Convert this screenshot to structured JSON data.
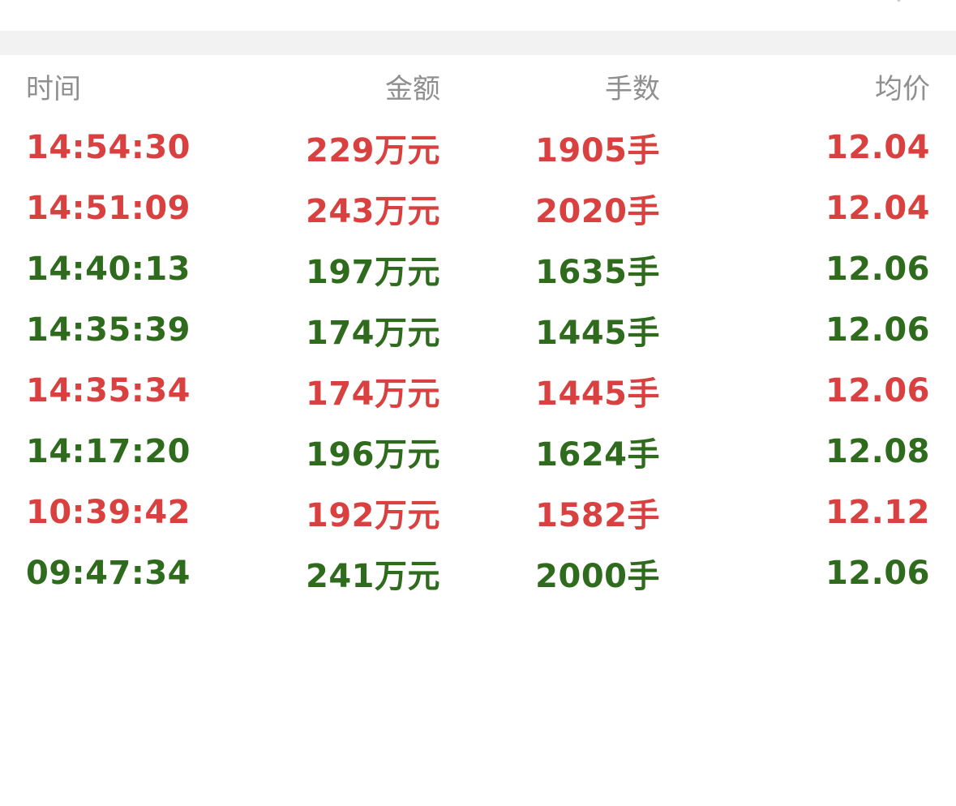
{
  "header": {
    "time": "时间",
    "amount": "金额",
    "lots": "手数",
    "avg_price": "均价"
  },
  "colors": {
    "up": "#d94040",
    "down": "#2f6b1c",
    "header_text": "#8f8f8f",
    "divider": "#f2f2f2"
  },
  "rows": [
    {
      "time": "14:54:30",
      "amount": "229万元",
      "lots": "1905手",
      "avg_price": "12.04",
      "direction": "up"
    },
    {
      "time": "14:51:09",
      "amount": "243万元",
      "lots": "2020手",
      "avg_price": "12.04",
      "direction": "up"
    },
    {
      "time": "14:40:13",
      "amount": "197万元",
      "lots": "1635手",
      "avg_price": "12.06",
      "direction": "down"
    },
    {
      "time": "14:35:39",
      "amount": "174万元",
      "lots": "1445手",
      "avg_price": "12.06",
      "direction": "down"
    },
    {
      "time": "14:35:34",
      "amount": "174万元",
      "lots": "1445手",
      "avg_price": "12.06",
      "direction": "up"
    },
    {
      "time": "14:17:20",
      "amount": "196万元",
      "lots": "1624手",
      "avg_price": "12.08",
      "direction": "down"
    },
    {
      "time": "10:39:42",
      "amount": "192万元",
      "lots": "1582手",
      "avg_price": "12.12",
      "direction": "up"
    },
    {
      "time": "09:47:34",
      "amount": "241万元",
      "lots": "2000手",
      "avg_price": "12.06",
      "direction": "down"
    }
  ],
  "icons": {
    "top_right": "chevron-right-icon"
  }
}
